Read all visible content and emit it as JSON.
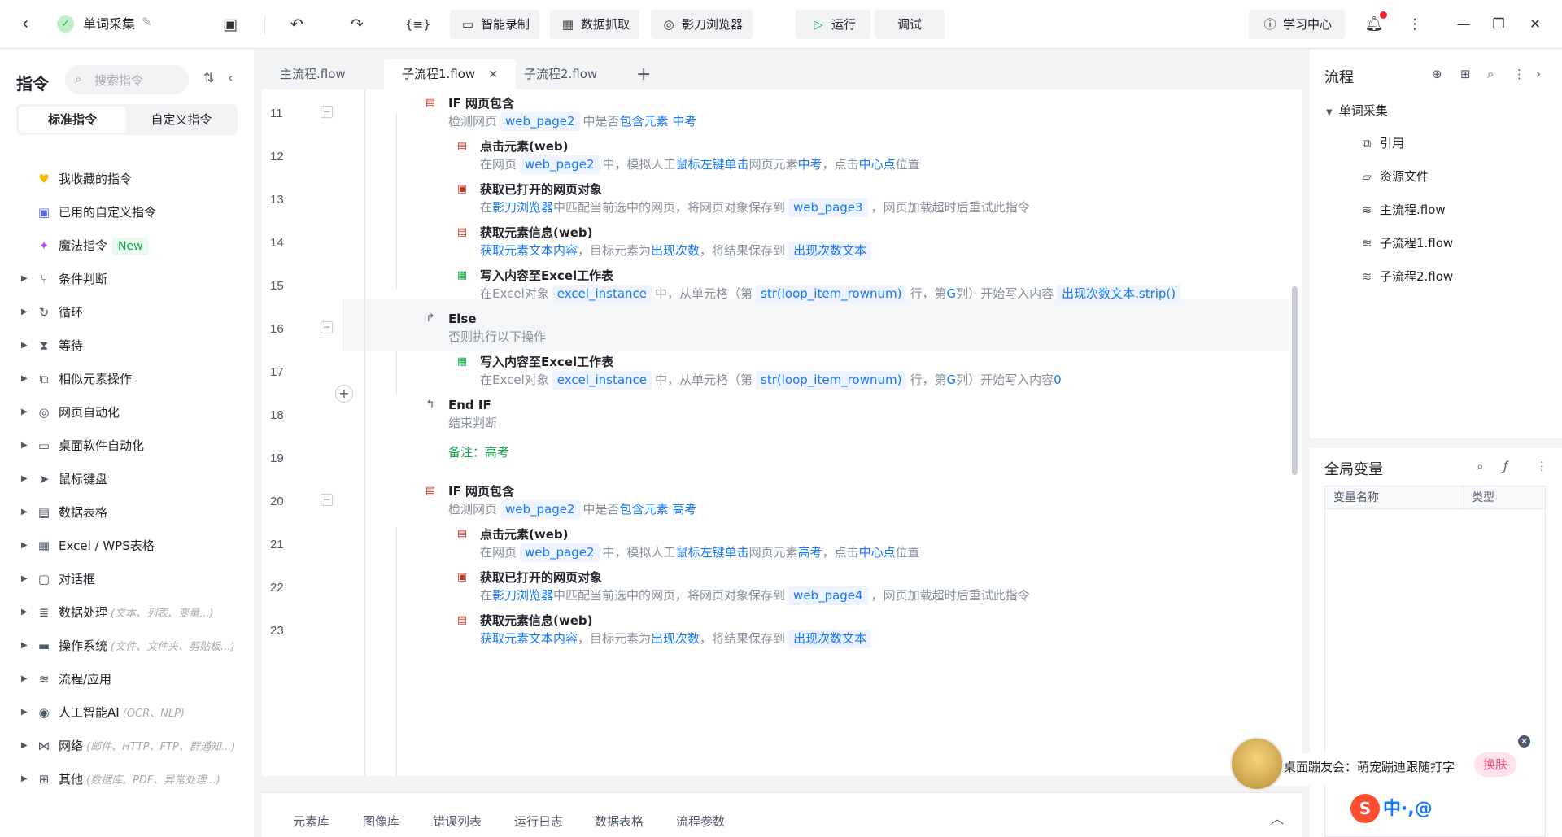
{
  "topbar": {
    "project_title": "单词采集",
    "btn_record": "智能录制",
    "btn_scrape": "数据抓取",
    "btn_browser": "影刀浏览器",
    "btn_run": "运行",
    "btn_debug": "调试",
    "btn_learn": "学习中心"
  },
  "sidebar": {
    "title": "指令",
    "search_placeholder": "搜索指令",
    "tabs": [
      "标准指令",
      "自定义指令"
    ],
    "items": [
      {
        "label": "我收藏的指令",
        "hint": "",
        "icon": "heart-icon"
      },
      {
        "label": "已用的自定义指令",
        "hint": "",
        "icon": "calendar-icon"
      },
      {
        "label": "魔法指令",
        "hint": "",
        "icon": "sparkle-icon",
        "badge": "New"
      },
      {
        "label": "条件判断",
        "hint": "",
        "icon": "branch-icon"
      },
      {
        "label": "循环",
        "hint": "",
        "icon": "loop-icon"
      },
      {
        "label": "等待",
        "hint": "",
        "icon": "hourglass-icon"
      },
      {
        "label": "相似元素操作",
        "hint": "",
        "icon": "copy-icon"
      },
      {
        "label": "网页自动化",
        "hint": "",
        "icon": "browser-icon"
      },
      {
        "label": "桌面软件自动化",
        "hint": "",
        "icon": "monitor-icon"
      },
      {
        "label": "鼠标键盘",
        "hint": "",
        "icon": "cursor-icon"
      },
      {
        "label": "数据表格",
        "hint": "",
        "icon": "table-icon"
      },
      {
        "label": "Excel / WPS表格",
        "hint": "",
        "icon": "excel-icon"
      },
      {
        "label": "对话框",
        "hint": "",
        "icon": "dialog-icon"
      },
      {
        "label": "数据处理",
        "hint": "(文本、列表、变量...)",
        "icon": "data-icon"
      },
      {
        "label": "操作系统",
        "hint": "(文件、文件夹、剪贴板...)",
        "icon": "os-icon"
      },
      {
        "label": "流程/应用",
        "hint": "",
        "icon": "layers-icon"
      },
      {
        "label": "人工智能AI",
        "hint": "(OCR、NLP)",
        "icon": "ai-icon"
      },
      {
        "label": "网络",
        "hint": "(邮件、HTTP、FTP、群通知...)",
        "icon": "network-icon"
      },
      {
        "label": "其他",
        "hint": "(数据库、PDF、异常处理...)",
        "icon": "grid-icon"
      }
    ]
  },
  "editor": {
    "tabs": [
      "主流程.flow",
      "子流程1.flow",
      "子流程2.flow"
    ],
    "active_tab_index": 1,
    "line_numbers": [
      "11",
      "12",
      "13",
      "14",
      "15",
      "16",
      "17",
      "18",
      "19",
      "20",
      "21",
      "22",
      "23"
    ],
    "steps": {
      "s11_title": "IF 网页包含",
      "s11_d1": "检测网页",
      "s11_c1": "web_page2",
      "s11_d2": "中是否",
      "s11_b1": "包含元素 中考",
      "s12_title": "点击元素(web)",
      "s12_d1": "在网页",
      "s12_c1": "web_page2",
      "s12_d2": "中，模拟人工",
      "s12_b1": "鼠标左键单击",
      "s12_d3": "网页元素",
      "s12_b2": "中考",
      "s12_d4": "，点击",
      "s12_b3": "中心点",
      "s12_d5": "位置",
      "s13_title": "获取已打开的网页对象",
      "s13_d1": "在",
      "s13_b1": "影刀浏览器",
      "s13_d2": "中匹配当前选中的网页，将网页对象保存到",
      "s13_c1": "web_page3",
      "s13_d3": "，网页加载超时后重试此指令",
      "s14_title": "获取元素信息(web)",
      "s14_b1": "获取元素文本内容",
      "s14_d1": "，目标元素为",
      "s14_b2": "出现次数",
      "s14_d2": "，将结果保存到",
      "s14_c1": "出现次数文本",
      "s15_title": "写入内容至Excel工作表",
      "s15_d1": "在Excel对象",
      "s15_c1": "excel_instance",
      "s15_d2": "中，从单元格（第",
      "s15_c2": "str(loop_item_rownum)",
      "s15_d3": "行，第",
      "s15_b1": "G",
      "s15_d4": "列）开始写入内容",
      "s15_c3": "出现次数文本.strip()",
      "s16_title": "Else",
      "s16_d1": "否则执行以下操作",
      "s17_title": "写入内容至Excel工作表",
      "s17_d1": "在Excel对象",
      "s17_c1": "excel_instance",
      "s17_d2": "中，从单元格（第",
      "s17_c2": "str(loop_item_rownum)",
      "s17_d3": "行，第",
      "s17_b1": "G",
      "s17_d4": "列）开始写入内容",
      "s17_b2": "0",
      "s18_title": "End IF",
      "s18_d1": "结束判断",
      "s19_note": "备注：高考",
      "s20_title": "IF 网页包含",
      "s20_d1": "检测网页",
      "s20_c1": "web_page2",
      "s20_d2": "中是否",
      "s20_b1": "包含元素 高考",
      "s21_title": "点击元素(web)",
      "s21_d1": "在网页",
      "s21_c1": "web_page2",
      "s21_d2": "中，模拟人工",
      "s21_b1": "鼠标左键单击",
      "s21_d3": "网页元素",
      "s21_b2": "高考",
      "s21_d4": "，点击",
      "s21_b3": "中心点",
      "s21_d5": "位置",
      "s22_title": "获取已打开的网页对象",
      "s22_d1": "在",
      "s22_b1": "影刀浏览器",
      "s22_d2": "中匹配当前选中的网页，将网页对象保存到",
      "s22_c1": "web_page4",
      "s22_d3": "，网页加载超时后重试此指令",
      "s23_title": "获取元素信息(web)",
      "s23_b1": "获取元素文本内容",
      "s23_d1": "，目标元素为",
      "s23_b2": "出现次数",
      "s23_d2": "，将结果保存到",
      "s23_c1": "出现次数文本"
    }
  },
  "bottom_tabs": [
    "元素库",
    "图像库",
    "错误列表",
    "运行日志",
    "数据表格",
    "流程参数"
  ],
  "right_panel": {
    "title": "流程",
    "tree_root": "单词采集",
    "tree_items": [
      "引用",
      "资源文件",
      "主流程.flow",
      "子流程1.flow",
      "子流程2.flow"
    ],
    "globals_title": "全局变量",
    "col_name": "变量名称",
    "col_type": "类型"
  },
  "popup": {
    "text": "桌面蹦友会：萌宠蹦迪跟随打字",
    "button": "换肤"
  },
  "ime": {
    "text": "中·,@"
  },
  "colors": {
    "accent_blue": "#1677ff",
    "note_green": "#13a64b",
    "notification_red": "#f5222d"
  }
}
